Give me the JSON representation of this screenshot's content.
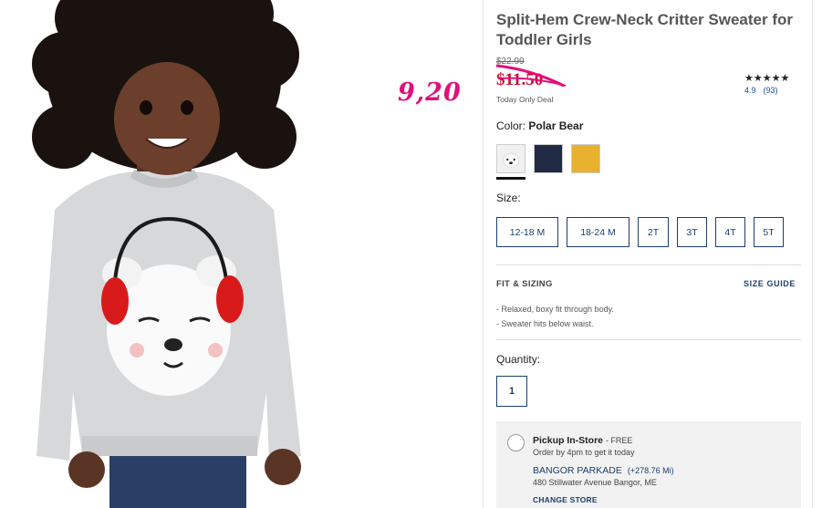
{
  "product": {
    "title": "Split-Hem Crew-Neck Critter Sweater for Toddler Girls",
    "original_price": "$22.99",
    "sale_price": "$11.50",
    "deal_label": "Today Only Deal",
    "rating": {
      "stars": "★★★★★",
      "score": "4.9",
      "count": "(93)"
    }
  },
  "annotation": {
    "text": "9,20",
    "color": "#e0107a"
  },
  "color": {
    "label": "Color:",
    "selected_name": "Polar Bear",
    "swatches": [
      {
        "name": "Polar Bear",
        "hex": "#f1f1f1",
        "selected": true
      },
      {
        "name": "Navy",
        "hex": "#202a44",
        "selected": false
      },
      {
        "name": "Gold",
        "hex": "#e8b230",
        "selected": false
      }
    ]
  },
  "size": {
    "label": "Size:",
    "options": [
      "12-18 M",
      "18-24 M",
      "2T",
      "3T",
      "4T",
      "5T"
    ]
  },
  "fit": {
    "title": "FIT & SIZING",
    "guide_link": "SIZE GUIDE",
    "notes": [
      "Relaxed, boxy fit through body.",
      "Sweater hits below waist."
    ]
  },
  "quantity": {
    "label": "Quantity:",
    "value": "1"
  },
  "pickup": {
    "title": "Pickup In-Store",
    "free": "- FREE",
    "order_by": "Order by 4pm to get it today",
    "store_name": "BANGOR PARKADE",
    "store_distance": "(+278.76 Mi)",
    "store_address": "480 Stillwater Avenue Bangor, ME",
    "change_label": "CHANGE STORE"
  },
  "colors": {
    "link": "#1d3f6e",
    "sale": "#c8102e",
    "annotation": "#e0107a"
  }
}
